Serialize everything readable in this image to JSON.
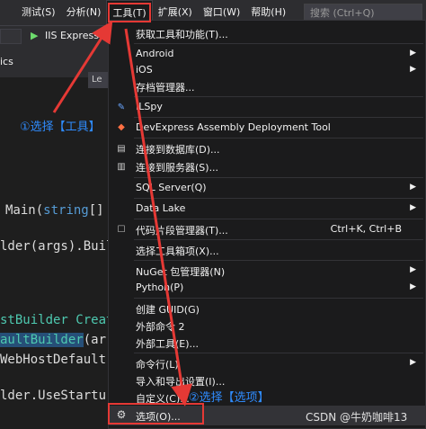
{
  "menubar": {
    "items": [
      "测试(S)",
      "分析(N)",
      "工具(T)",
      "扩展(X)",
      "窗口(W)",
      "帮助(H)"
    ],
    "search_placeholder": "搜索 (Ctrl+Q)"
  },
  "toolbar": {
    "run_label": "IIS Express"
  },
  "tabs": {
    "left_tab": "ics",
    "second_tab": "Le"
  },
  "code": {
    "line1_prefix": "Main(",
    "line1_kw": "string",
    "line1_suffix": "[]",
    "line2": "lder(args).Buil",
    "line3": "stBuilder Create",
    "line4_hl": "aultBuilder",
    "line4_rest": "(ar",
    "line5": "WebHostDefault",
    "line6": "lder.UseStartu"
  },
  "annotations": {
    "step1": "①选择【工具】",
    "step2": "②选择【选项】"
  },
  "menu": {
    "items": [
      {
        "label": "获取工具和功能(T)...",
        "arrow": false,
        "shortcut": "",
        "icon": ""
      },
      {
        "label": "Android",
        "arrow": true,
        "shortcut": "",
        "icon": ""
      },
      {
        "label": "iOS",
        "arrow": true,
        "shortcut": "",
        "icon": ""
      },
      {
        "label": "存档管理器...",
        "arrow": false,
        "shortcut": "",
        "icon": ""
      },
      {
        "label": "ILSpy",
        "arrow": false,
        "shortcut": "",
        "icon": "ilspy-icon"
      },
      {
        "label": "DevExpress Assembly Deployment Tool",
        "arrow": false,
        "shortcut": "",
        "icon": "devexpress-icon"
      },
      {
        "label": "连接到数据库(D)...",
        "arrow": false,
        "shortcut": "",
        "icon": "database-connect-icon"
      },
      {
        "label": "连接到服务器(S)...",
        "arrow": false,
        "shortcut": "",
        "icon": "server-connect-icon"
      },
      {
        "label": "SQL Server(Q)",
        "arrow": true,
        "shortcut": "",
        "icon": ""
      },
      {
        "label": "Data Lake",
        "arrow": true,
        "shortcut": "",
        "icon": ""
      },
      {
        "label": "代码片段管理器(T)...",
        "arrow": false,
        "shortcut": "Ctrl+K, Ctrl+B",
        "icon": "snippet-icon"
      },
      {
        "label": "选择工具箱项(X)...",
        "arrow": false,
        "shortcut": "",
        "icon": ""
      },
      {
        "label": "NuGet 包管理器(N)",
        "arrow": true,
        "shortcut": "",
        "icon": ""
      },
      {
        "label": "Python(P)",
        "arrow": true,
        "shortcut": "",
        "icon": ""
      },
      {
        "label": "创建 GUID(G)",
        "arrow": false,
        "shortcut": "",
        "icon": ""
      },
      {
        "label": "外部命令 2",
        "arrow": false,
        "shortcut": "",
        "icon": ""
      },
      {
        "label": "外部工具(E)...",
        "arrow": false,
        "shortcut": "",
        "icon": ""
      },
      {
        "label": "命令行(L)",
        "arrow": true,
        "shortcut": "",
        "icon": ""
      },
      {
        "label": "导入和导出设置(I)...",
        "arrow": false,
        "shortcut": "",
        "icon": ""
      },
      {
        "label": "自定义(C)...",
        "arrow": false,
        "shortcut": "",
        "icon": ""
      },
      {
        "label": "选项(O)...",
        "arrow": false,
        "shortcut": "",
        "icon": "gear-icon"
      }
    ]
  },
  "watermark": "CSDN @牛奶咖啡13",
  "colors": {
    "annotation": "#2f8cff",
    "highlight": "#e53935",
    "menu_bg": "#1b1b1c"
  }
}
